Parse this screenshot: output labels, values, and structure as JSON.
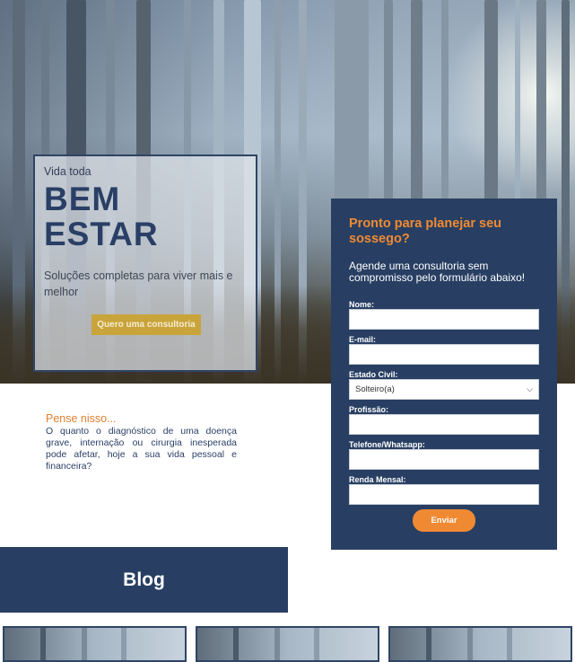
{
  "hero": {
    "kicker": "Vida toda",
    "title_line1": "BEM",
    "title_line2": "ESTAR",
    "subtitle": "Soluções completas para viver mais e melhor",
    "cta_label": "Quero uma consultoria"
  },
  "think": {
    "title": "Pense nisso...",
    "text": "O quanto o diagnóstico de uma doença grave, internação ou cirurgia inesperada pode afetar, hoje a sua vida pessoal e financeira?"
  },
  "form": {
    "title": "Pronto para planejar seu sossego?",
    "subtitle": "Agende uma consultoria sem compromisso pelo formulário abaixo!",
    "fields": [
      {
        "label": "Nome:",
        "value": ""
      },
      {
        "label": "E-mail:",
        "value": ""
      },
      {
        "label": "Estado Civil:",
        "value": "Solteiro(a)"
      },
      {
        "label": "Profissão:",
        "value": ""
      },
      {
        "label": "Telefone/Whatsapp:",
        "value": ""
      },
      {
        "label": "Renda Mensal:",
        "value": ""
      }
    ],
    "submit_label": "Enviar"
  },
  "blog": {
    "title": "Blog"
  },
  "colors": {
    "navy": "#283f63",
    "orange": "#ef8a33",
    "gold": "#c9a43a"
  }
}
